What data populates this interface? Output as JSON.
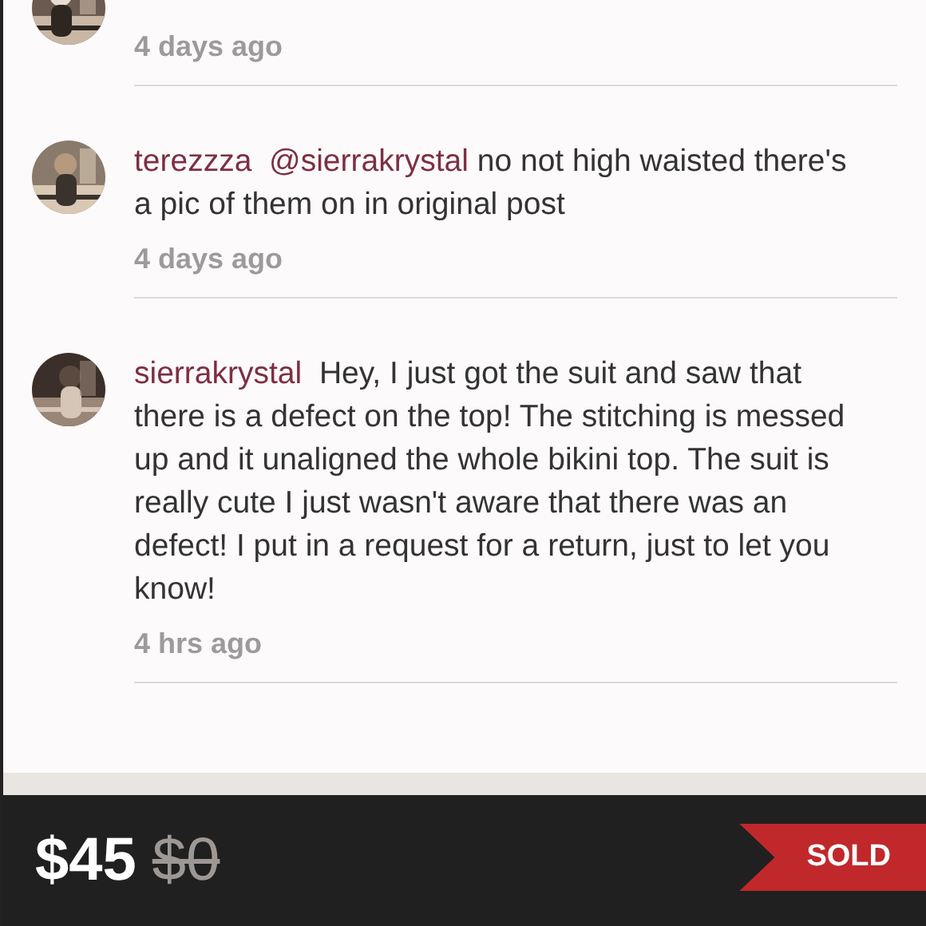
{
  "comments": [
    {
      "time": "4 days ago"
    },
    {
      "user": "terezzza",
      "mention": "@sierrakrystal",
      "text": "no not high waisted there's a pic of them on in original post",
      "time": "4 days ago"
    },
    {
      "user": "sierrakrystal",
      "text": "Hey, I just got the suit and saw that there is a defect on the top! The stitching is messed up and it unaligned the whole bikini top. The suit is really cute I just wasn't aware that there was an defect! I put in a request for a return, just to let you know!",
      "time": "4 hrs ago"
    }
  ],
  "listing": {
    "price": "$45",
    "original_price": "$0",
    "status": "SOLD"
  }
}
